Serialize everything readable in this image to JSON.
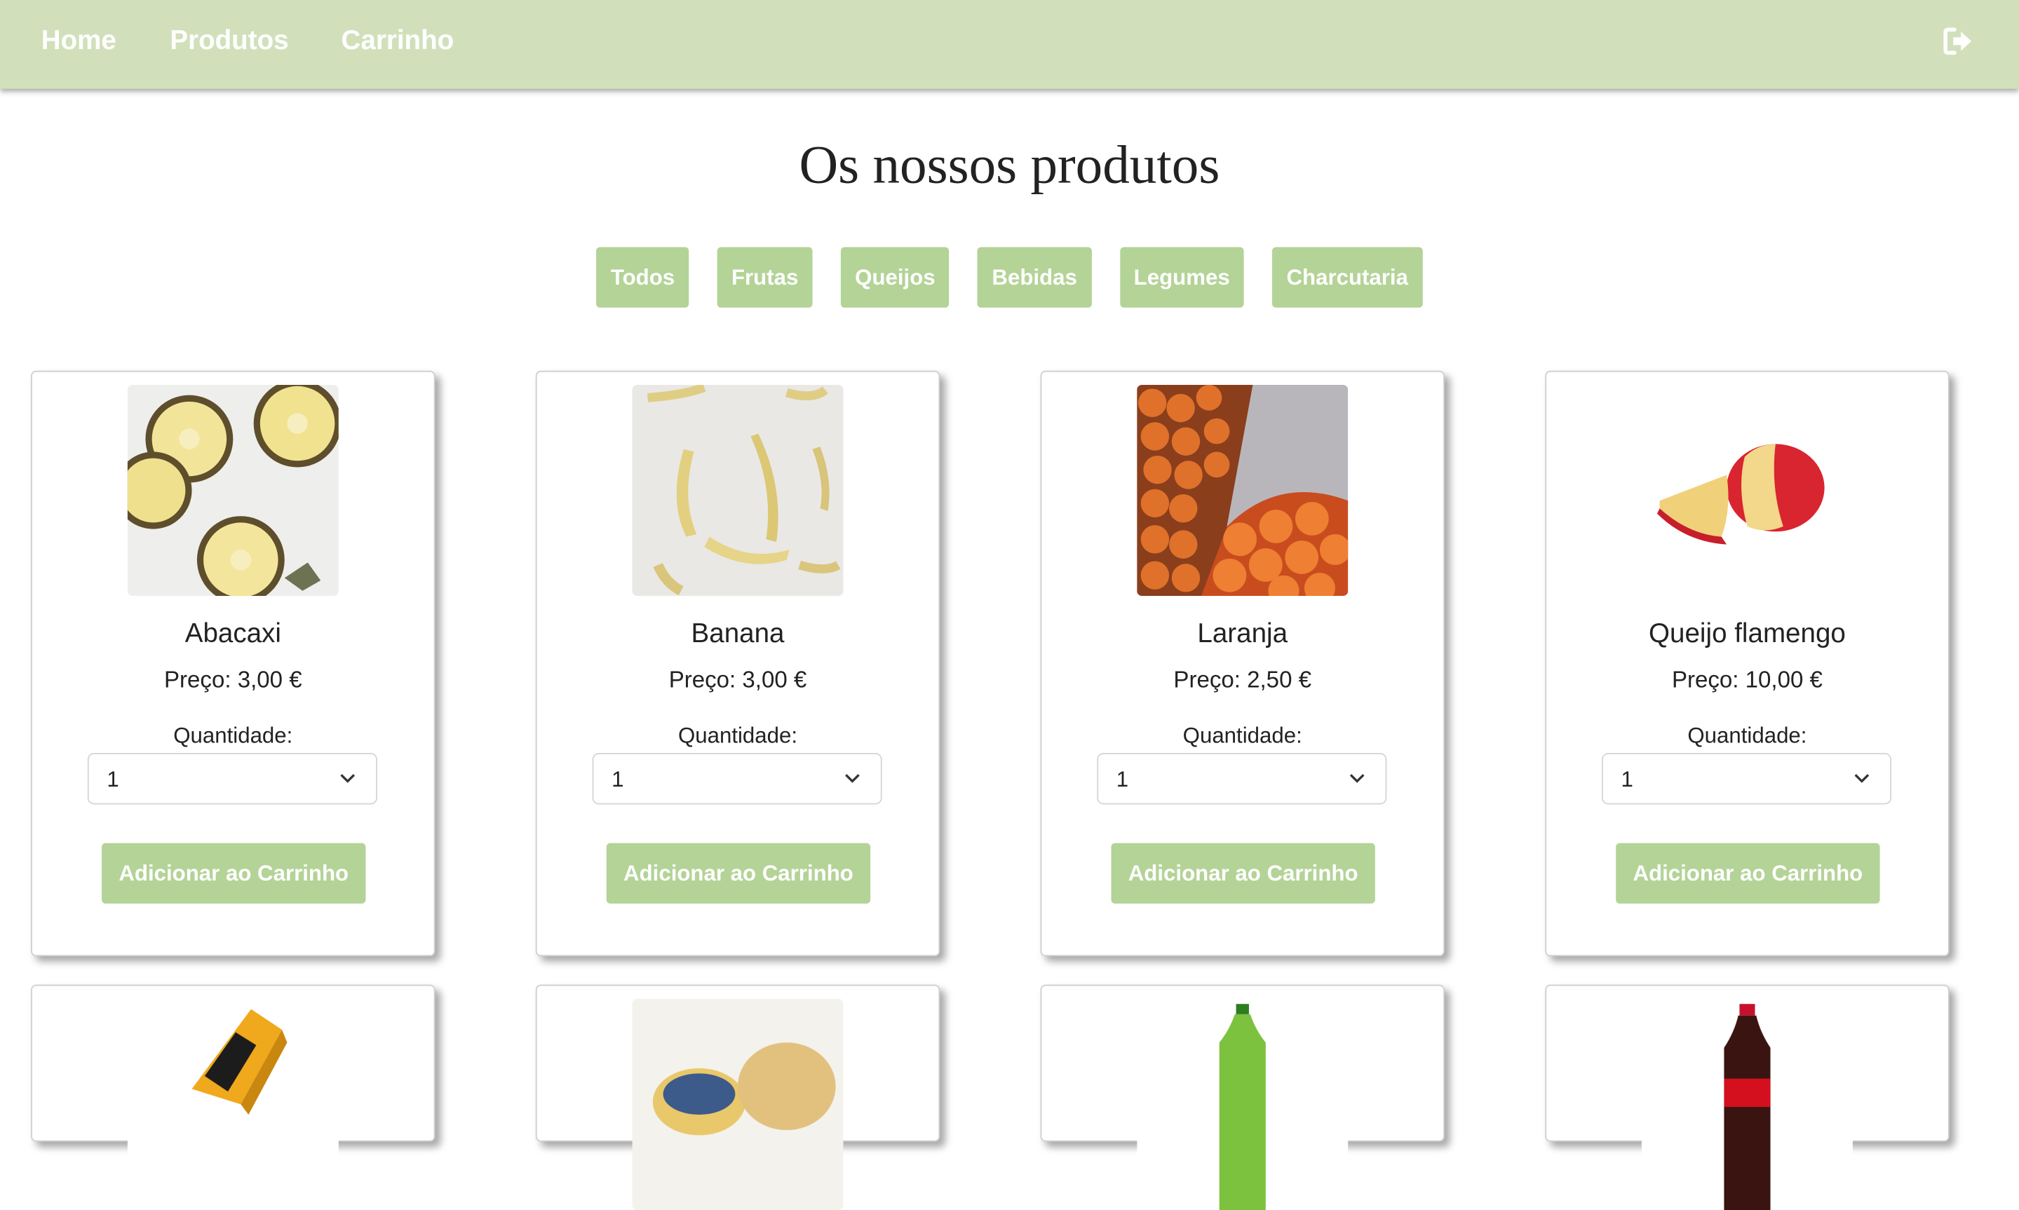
{
  "nav": {
    "links": [
      "Home",
      "Produtos",
      "Carrinho"
    ],
    "logout_icon": "sign-out-icon"
  },
  "page_title": "Os nossos produtos",
  "filters": [
    "Todos",
    "Frutas",
    "Queijos",
    "Bebidas",
    "Legumes",
    "Charcutaria"
  ],
  "products": [
    {
      "name": "Abacaxi",
      "price": "Preço: 3,00 €",
      "qty_label": "Quantidade:",
      "qty": "1",
      "button": "Adicionar ao Carrinho",
      "image": "pineapple-slices"
    },
    {
      "name": "Banana",
      "price": "Preço: 3,00 €",
      "qty_label": "Quantidade:",
      "qty": "1",
      "button": "Adicionar ao Carrinho",
      "image": "bananas"
    },
    {
      "name": "Laranja",
      "price": "Preço: 2,50 €",
      "qty_label": "Quantidade:",
      "qty": "1",
      "button": "Adicionar ao Carrinho",
      "image": "oranges"
    },
    {
      "name": "Queijo flamengo",
      "price": "Preço: 10,00 €",
      "qty_label": "Quantidade:",
      "qty": "1",
      "button": "Adicionar ao Carrinho",
      "image": "edam-cheese"
    }
  ],
  "products_row2_images": [
    "cheddar-cheese",
    "round-cheeses",
    "green-soda-bottle",
    "cola-bottle"
  ],
  "colors": {
    "navbar": "#d1e0bb",
    "button": "#b4d397"
  }
}
